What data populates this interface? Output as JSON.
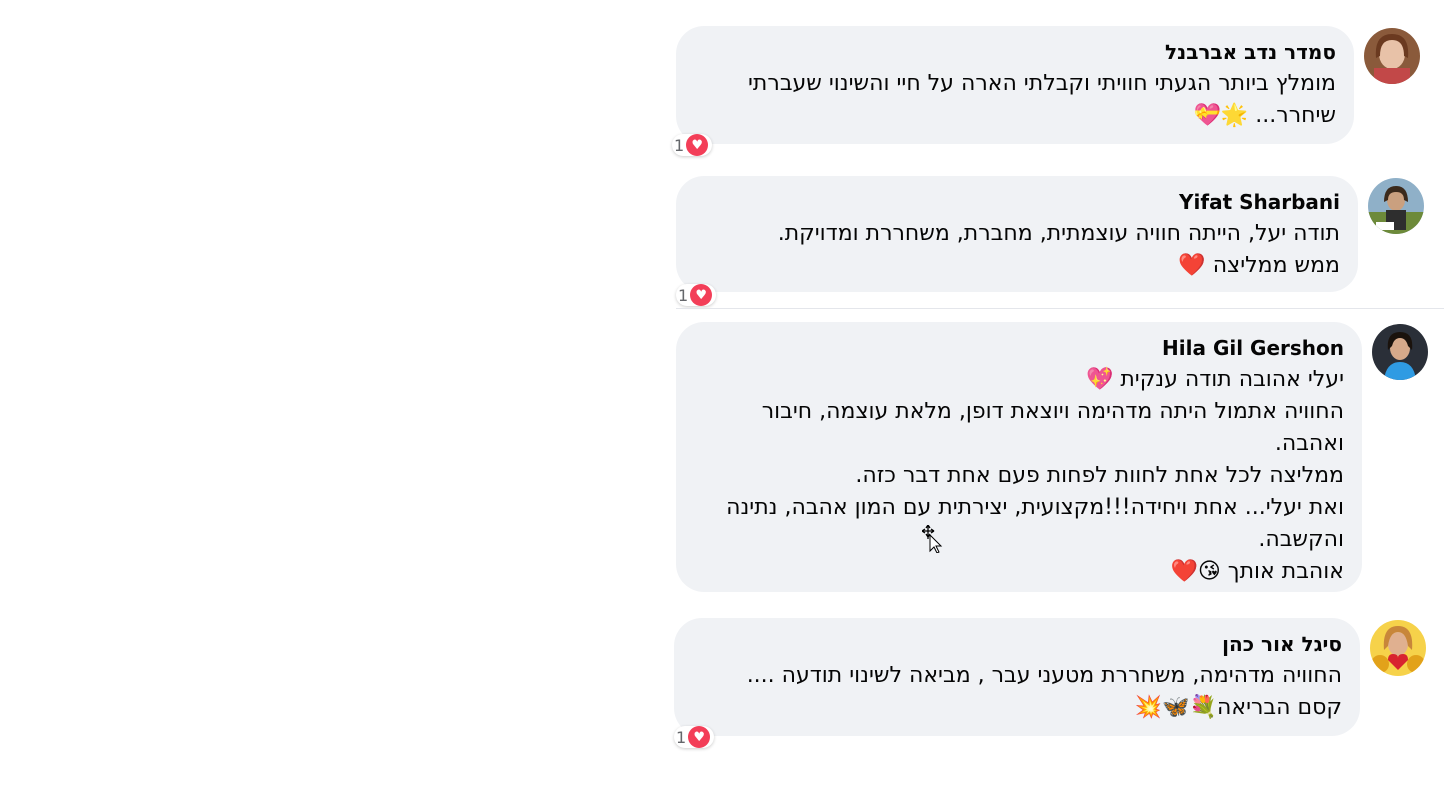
{
  "comments": [
    {
      "author": "סמדר נדב אברבנל",
      "lines": [
        "מומלץ ביותר הגעתי חוויתי וקבלתי הארה על חיי והשינוי שעברתי",
        "שיחרר... 🌟💝"
      ],
      "reaction_count": "1"
    },
    {
      "author": "Yifat Sharbani",
      "lines": [
        "תודה יעל, הייתה חוויה עוצמתית, מחברת, משחררת ומדויקת.",
        "ממש ממליצה ❤️"
      ],
      "reaction_count": "1"
    },
    {
      "author": "Hila Gil Gershon",
      "lines": [
        "יעלי אהובה תודה ענקית 💖",
        "החוויה אתמול היתה מדהימה ויוצאת דופן, מלאת עוצמה, חיבור",
        "ואהבה.",
        "ממליצה לכל אחת לחוות לפחות פעם אחת דבר כזה.",
        "ואת יעלי... אחת ויחידה!!!מקצועית, יצירתית עם המון אהבה, נתינה",
        "והקשבה.",
        "אוהבת אותך 😘❤️"
      ]
    },
    {
      "author": "סיגל אור כהן",
      "lines": [
        "החוויה מדהימה, משחררת מטעני עבר , מביאה לשינוי תודעה ....",
        "קסם הבריאה💐🦋💥"
      ],
      "reaction_count": "1"
    }
  ],
  "icons": {
    "reaction": "heart-reaction-icon",
    "cursor": "move-cursor-icon"
  },
  "colors": {
    "bubble": "#f0f2f5",
    "heart": "#f33e58"
  }
}
